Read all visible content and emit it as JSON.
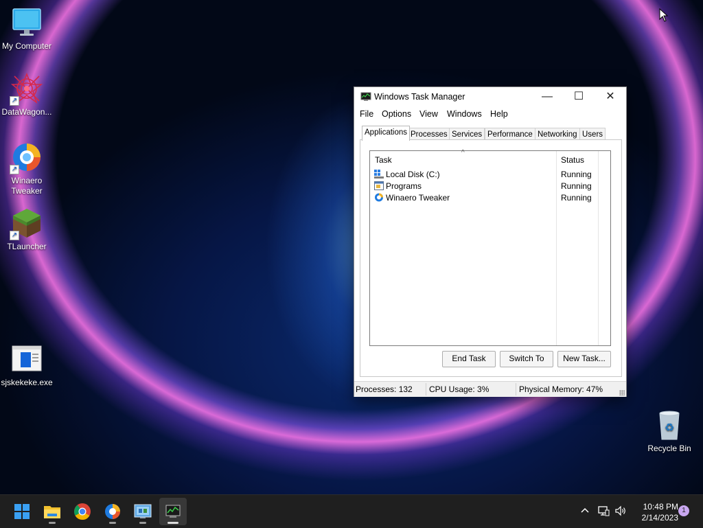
{
  "desktop": {
    "icons": [
      {
        "label": "My Computer",
        "icon": "monitor-icon",
        "shortcut": false
      },
      {
        "label": "DataWagon...",
        "icon": "datawagon-icon",
        "shortcut": true
      },
      {
        "label": "Winaero\nTweaker",
        "icon": "winaero-icon",
        "shortcut": true
      },
      {
        "label": "TLauncher",
        "icon": "minecraft-grass-block-icon",
        "shortcut": true
      },
      {
        "label": "sjskekeke.exe",
        "icon": "executable-file-icon",
        "shortcut": false
      },
      {
        "label": "Recycle Bin",
        "icon": "recycle-bin-icon",
        "shortcut": false
      }
    ]
  },
  "task_manager": {
    "title": "Windows Task Manager",
    "controls": {
      "minimize": "—",
      "maximize": "☐",
      "close": "✕"
    },
    "menu": [
      "File",
      "Options",
      "View",
      "Windows",
      "Help"
    ],
    "tabs": [
      "Applications",
      "Processes",
      "Services",
      "Performance",
      "Networking",
      "Users"
    ],
    "active_tab": "Applications",
    "list": {
      "columns": [
        "Task",
        "Status"
      ],
      "sort_indicator": "^",
      "rows": [
        {
          "task": "Local Disk (C:)",
          "status": "Running",
          "icon": "drive-icon"
        },
        {
          "task": "Programs",
          "status": "Running",
          "icon": "folder-window-icon"
        },
        {
          "task": "Winaero Tweaker",
          "status": "Running",
          "icon": "winaero-icon"
        }
      ]
    },
    "buttons": {
      "end_task": "End Task",
      "switch_to": "Switch To",
      "new_task": "New Task..."
    },
    "status": {
      "processes": "Processes: 132",
      "cpu": "CPU Usage: 3%",
      "memory": "Physical Memory: 47%"
    }
  },
  "taskbar": {
    "apps": [
      {
        "icon": "windows-start-icon"
      },
      {
        "icon": "file-explorer-icon"
      },
      {
        "icon": "chrome-icon"
      },
      {
        "icon": "winaero-icon"
      },
      {
        "icon": "control-panel-icon"
      },
      {
        "icon": "task-manager-icon",
        "active": true
      }
    ],
    "tray": {
      "chevron": "^",
      "clock_time": "10:48 PM",
      "clock_date": "2/14/2023",
      "notifications": "1"
    }
  }
}
